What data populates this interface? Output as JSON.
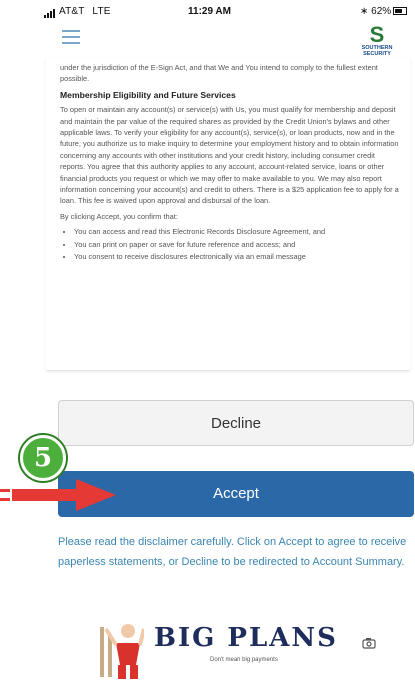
{
  "status_bar": {
    "carrier": "AT&T",
    "network": "LTE",
    "time": "11:29 AM",
    "battery": "62%",
    "icons": [
      "signal-icon",
      "bluetooth-icon",
      "battery-icon"
    ]
  },
  "header": {
    "menu_icon": "hamburger-menu-icon",
    "logo_line1": "SOUTHERN",
    "logo_line2": "SECURITY"
  },
  "document": {
    "intro_text": "under the jurisdiction of the E-Sign Act, and that We and You intend to comply to the fullest extent possible.",
    "section_title": "Membership Eligibility and Future Services",
    "section_body": "To open or maintain any account(s) or service(s) with Us, you must qualify for membership and deposit and maintain the par value of the required shares as provided by the Credit Union's bylaws and other applicable laws. To verify your eligibility for any account(s), service(s), or loan products, now and in the future, you authorize us to make inquiry to determine your employment history and to obtain information concerning any accounts with other institutions and your credit history, including consumer credit reports. You agree that this authority applies to any account, account-related service, loans or other financial products you request or which we may offer to make available to you. We may also report information concerning your account(s) and credit to others. There is a $25 application fee to apply for a loan. This fee is waived upon approval and disbursal of the loan.",
    "confirm_intro": "By clicking Accept, you confirm that:",
    "bullets": [
      "You can access and read this Electronic Records Disclosure Agreement, and",
      "You can print on paper or save for future reference and access; and",
      "You consent to receive disclosures electronically via an email message"
    ]
  },
  "actions": {
    "decline_label": "Decline",
    "accept_label": "Accept"
  },
  "annotation": {
    "step_number": "5"
  },
  "disclaimer": "Please read the disclaimer carefully. Click on Accept to agree to receive paperless statements, or Decline to be redirected to Account Summary.",
  "banner": {
    "headline": "BIG PLANS",
    "subline": "Don't mean big payments"
  },
  "colors": {
    "accept_button": "#2b68a8",
    "disclaimer_text": "#3a86b0",
    "step_badge": "#4caf3c",
    "arrow": "#e53935"
  }
}
